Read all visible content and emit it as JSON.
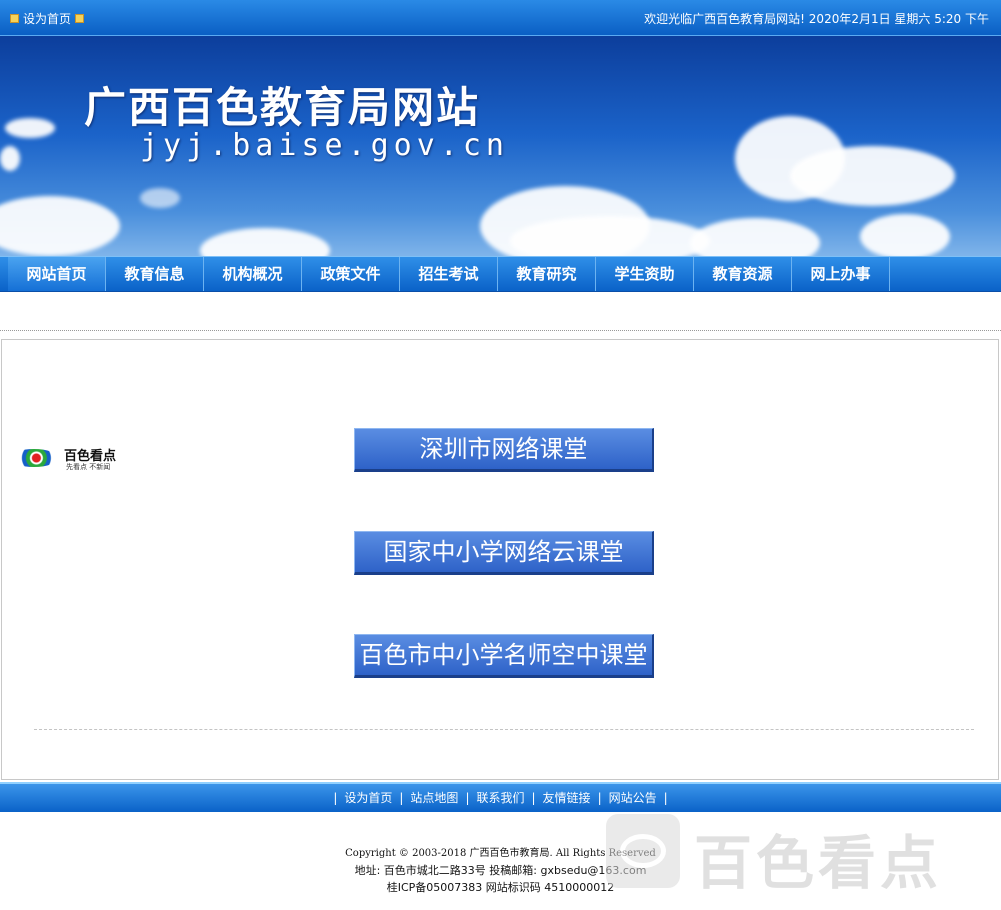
{
  "topbar": {
    "set_home": "设为首页",
    "welcome": "欢迎光临广西百色教育局网站! 2020年2月1日 星期六 5:20 下午"
  },
  "banner": {
    "title": "广西百色教育局网站",
    "domain": "jyj.baise.gov.cn"
  },
  "nav": {
    "items": [
      {
        "label": "网站首页",
        "active": true
      },
      {
        "label": "教育信息"
      },
      {
        "label": "机构概况"
      },
      {
        "label": "政策文件"
      },
      {
        "label": "招生考试"
      },
      {
        "label": "教育研究"
      },
      {
        "label": "学生资助"
      },
      {
        "label": "教育资源"
      },
      {
        "label": "网上办事"
      }
    ]
  },
  "logo": {
    "name": "百色看点",
    "slogan": "先看点 不新闻"
  },
  "courses": [
    {
      "label": "深圳市网络课堂"
    },
    {
      "label": "国家中小学网络云课堂"
    },
    {
      "label": "百色市中小学名师空中课堂"
    }
  ],
  "footer": {
    "links": [
      "设为首页",
      "站点地图",
      "联系我们",
      "友情链接",
      "网站公告"
    ],
    "copyright": "Copyright © 2003-2018 广西百色市教育局. All Rights Reserved",
    "address": "地址: 百色市城北二路33号 投稿邮箱: gxbsedu@163.com",
    "icp": "桂ICP备05007383 网站标识码 4510000012"
  },
  "watermark": {
    "text": "百色看点"
  },
  "colors": {
    "bar_blue": "#0a62c8",
    "button_blue": "#3a6fd0",
    "sky_blue": "#1b63c9"
  }
}
